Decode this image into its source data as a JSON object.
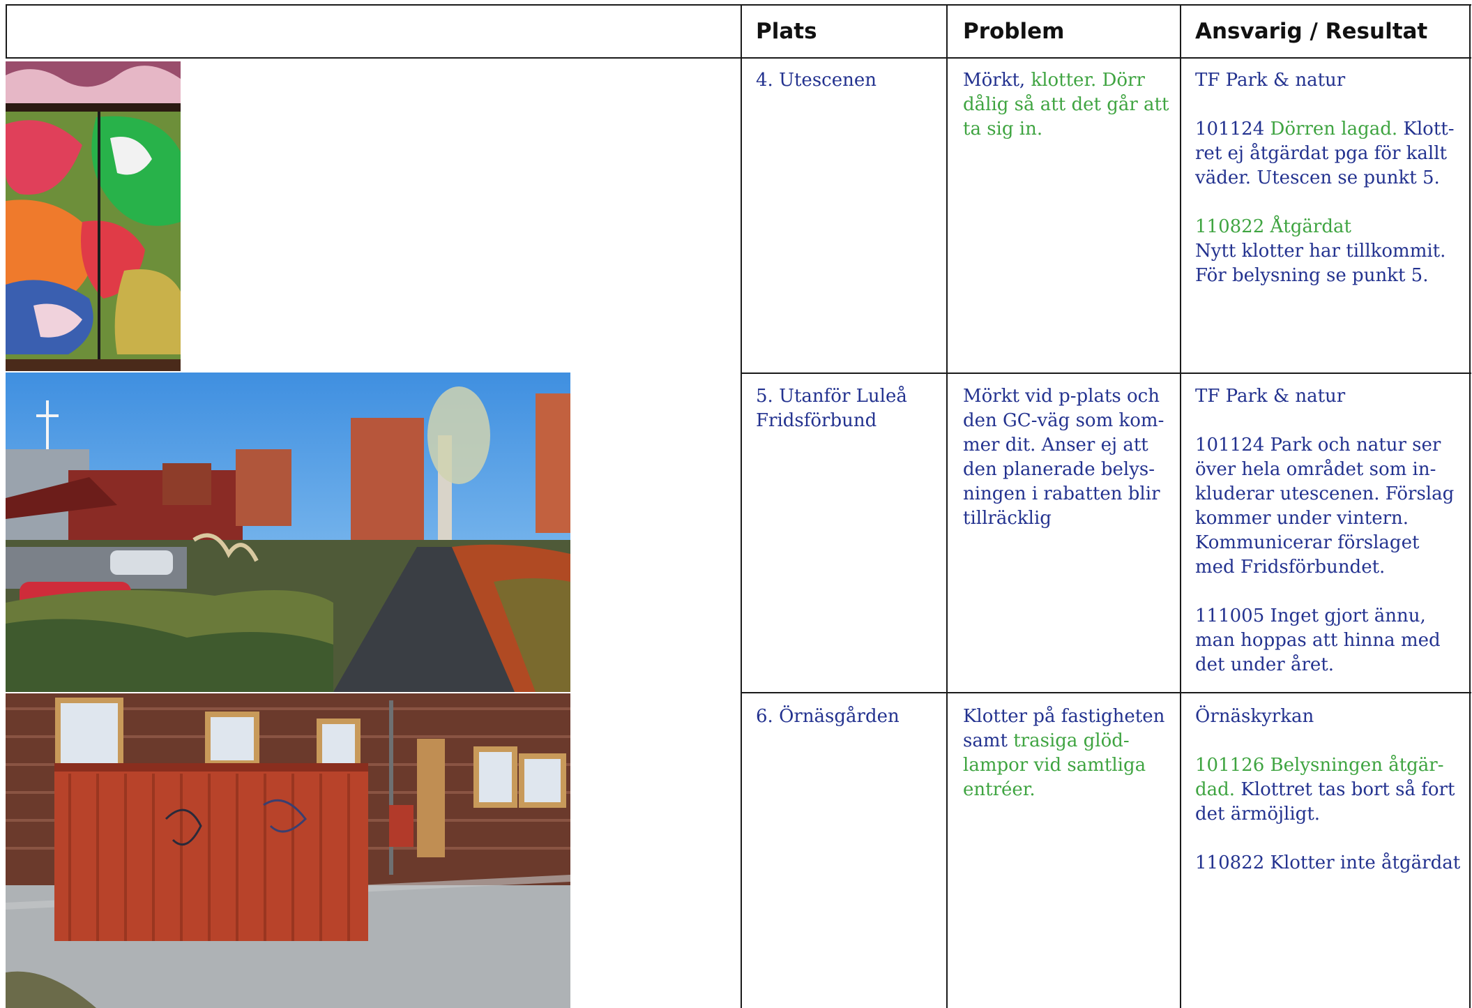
{
  "header": {
    "col_plats": "Plats",
    "col_problem": "Problem",
    "col_ansvarig": "Ansvarig / Resultat"
  },
  "rows": [
    {
      "plats": "4. Utescenen",
      "problem": {
        "part1": "Mörkt, ",
        "part2": "klotter. Dörr dålig så att det går att ta sig in."
      },
      "ansvarig": {
        "owner": "TF Park & natur",
        "u1_date": "101124 ",
        "u1_green": "Dörren lagad.",
        "u1_rest": " Klott-ret ej åtgärdat pga för kallt väder. Utescen se punkt 5.",
        "u2_green": "110822 Åtgärdat",
        "u2_rest": "Nytt klotter har tillkommit. För belysning se punkt 5."
      },
      "photo_icon": "graffiti-photo"
    },
    {
      "plats": "5.  Utanför Luleå Fridsförbund",
      "problem": {
        "text": "Mörkt vid p-plats och den GC-väg som kom-mer dit. Anser ej att den planerade belys-ningen i rabatten blir tillräcklig"
      },
      "ansvarig": {
        "owner": "TF Park & natur",
        "u1": "101124 Park och natur ser över hela området som in-kluderar utescenen. Förslag kommer under vintern. Kommunicerar förslaget med Fridsförbundet.",
        "u2": "111005 Inget gjort ännu, man hoppas att hinna med det under året."
      },
      "photo_icon": "path-photo"
    },
    {
      "plats": "6. Örnäsgården",
      "problem": {
        "part1": "Klotter på fastigheten samt ",
        "part2": "trasiga glöd-lampor vid samtliga entréer."
      },
      "ansvarig": {
        "owner": "Örnäskyrkan",
        "u1_green": "101126 Belysningen åtgär-dad.",
        "u1_rest": " Klottret tas bort så fort det ärmöjligt.",
        "u2": "110822 Klotter inte åtgärdat"
      },
      "photo_icon": "shed-photo"
    }
  ],
  "colors": {
    "blue_text": "#23328f",
    "green_text": "#3fa441",
    "grid": "#1a1a1a"
  }
}
